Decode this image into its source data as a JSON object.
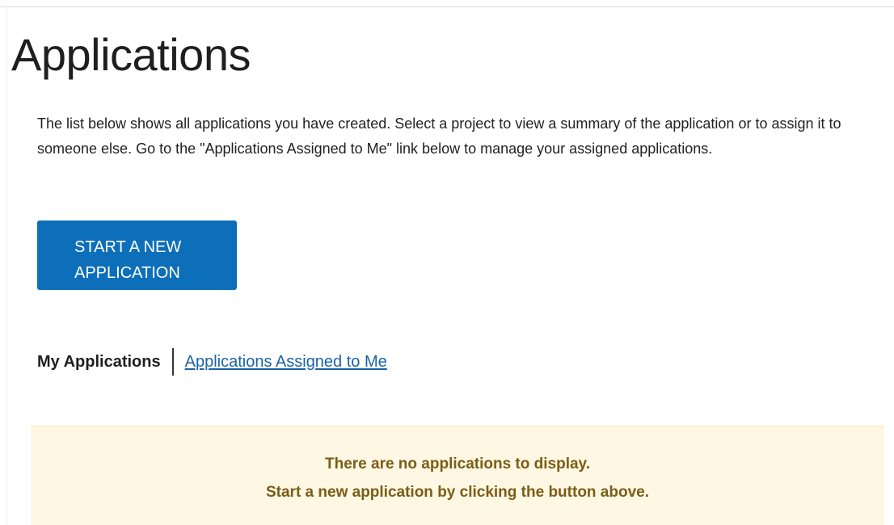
{
  "page": {
    "title": "Applications",
    "intro": "The list below shows all applications you have created. Select a project to view a summary of the application or to assign it to someone else. Go to the \"Applications Assigned to Me\" link below to manage your assigned applications."
  },
  "actions": {
    "start_button_line1": "START A NEW",
    "start_button_line2": "APPLICATION"
  },
  "tabs": {
    "current": "My Applications",
    "assigned_link": "Applications Assigned to Me"
  },
  "empty_state": {
    "line1": "There are no applications to display.",
    "line2": "Start a new application by clicking the button above."
  },
  "colors": {
    "primary_button": "#0d6fba",
    "link": "#1a62a8",
    "notice_background": "#fdf7e3",
    "notice_text": "#7a5d16"
  }
}
